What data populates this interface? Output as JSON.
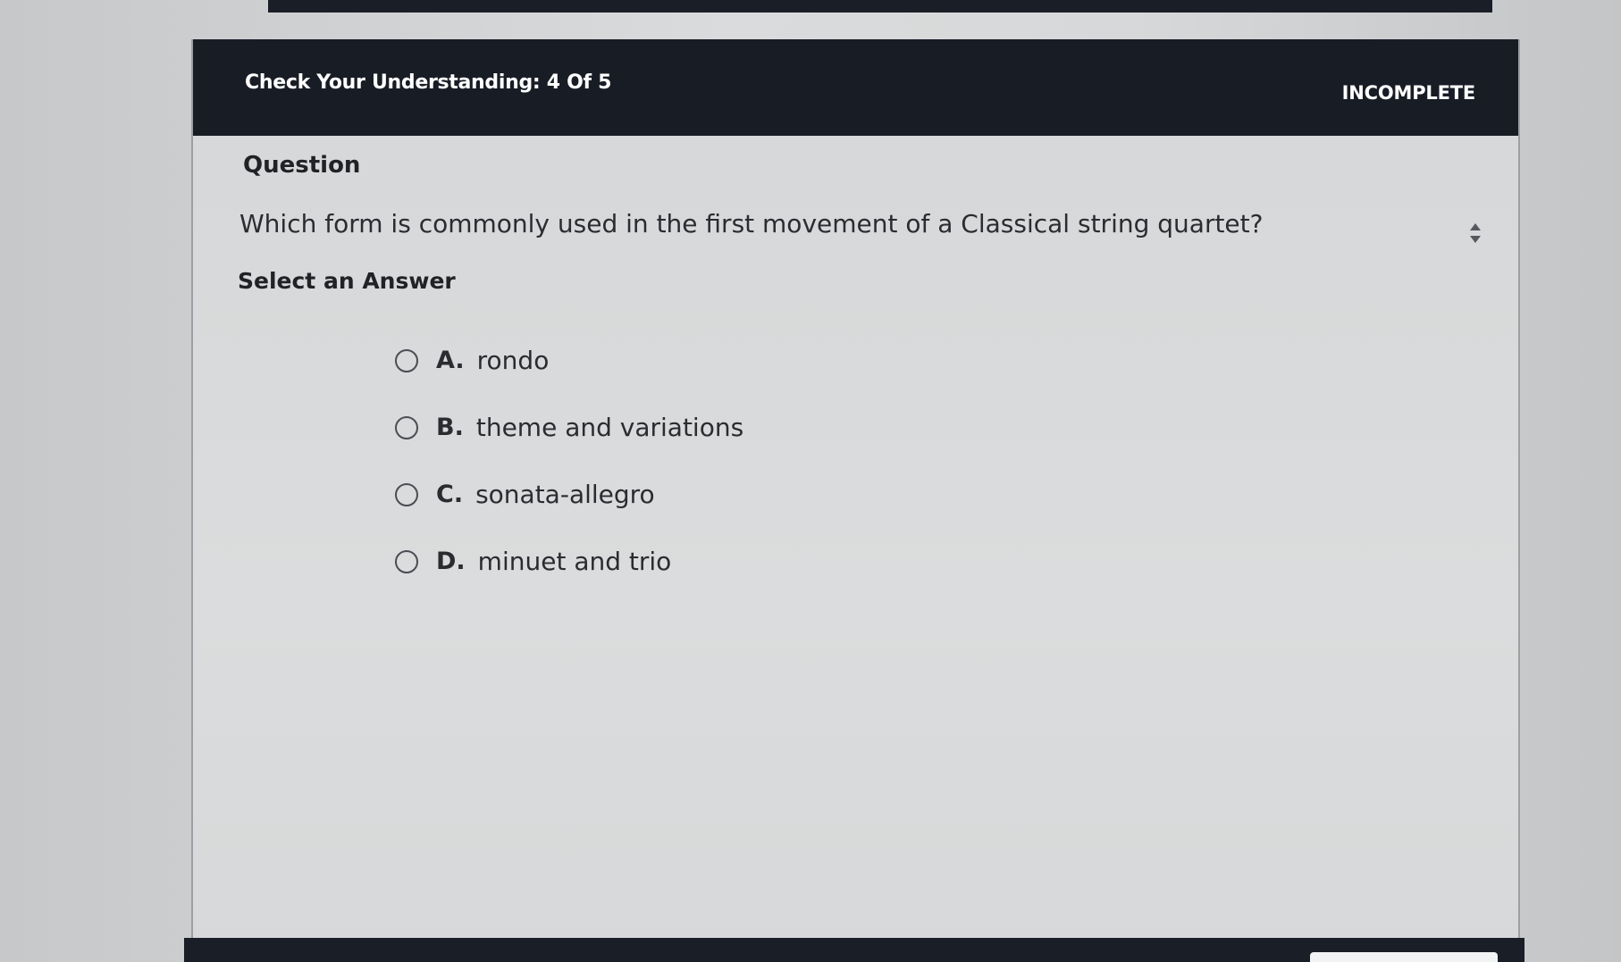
{
  "header": {
    "title": "Check Your Understanding: 4 Of 5",
    "status": "INCOMPLETE"
  },
  "question": {
    "section_label": "Question",
    "text": "Which form is commonly used in the first movement of a Classical string quartet?",
    "select_label": "Select an Answer"
  },
  "answers": [
    {
      "letter": "A.",
      "text": "rondo"
    },
    {
      "letter": "B.",
      "text": "theme and variations"
    },
    {
      "letter": "C.",
      "text": "sonata-allegro"
    },
    {
      "letter": "D.",
      "text": "minuet and trio"
    }
  ],
  "icons": {
    "resize": "resize-handle-icon",
    "radio": "radio-unselected-icon"
  },
  "colors": {
    "header_bg": "#181c25",
    "header_text": "#ffffff",
    "body_text": "#2a2c30"
  }
}
